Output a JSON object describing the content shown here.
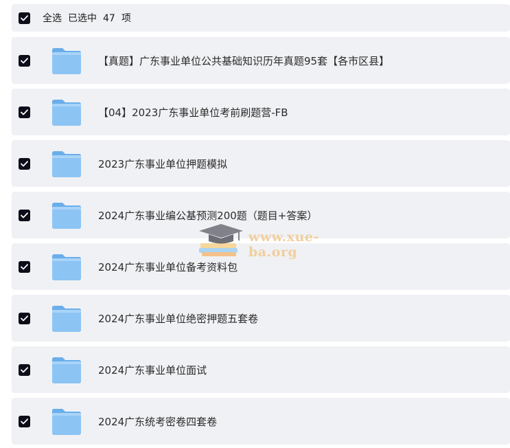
{
  "header": {
    "select_all": "全选",
    "selected_prefix": "已选中",
    "selected_count": "47",
    "selected_suffix": "项"
  },
  "items": [
    {
      "label": "【真题】广东事业单位公共基础知识历年真题95套【各市区县】",
      "checked": true
    },
    {
      "label": "【04】2023广东事业单位考前刷题营-FB",
      "checked": true
    },
    {
      "label": "2023广东事业单位押题模拟",
      "checked": true
    },
    {
      "label": "2024广东事业编公基预测200题（题目+答案）",
      "checked": true
    },
    {
      "label": "2024广东事业单位备考资料包",
      "checked": true
    },
    {
      "label": "2024广东事业单位绝密押题五套卷",
      "checked": true
    },
    {
      "label": "2024广东事业单位面试",
      "checked": true
    },
    {
      "label": "2024广东统考密卷四套卷",
      "checked": true
    }
  ],
  "icons": {
    "checkbox": "checkmark-icon",
    "folder": "folder-icon"
  },
  "colors": {
    "checkbox_bg": "#0d0d1a",
    "row_bg": "#f0f1f4",
    "folder_blue": "#7ab8f0"
  },
  "watermark": {
    "text": "www.xue-ba.org"
  }
}
